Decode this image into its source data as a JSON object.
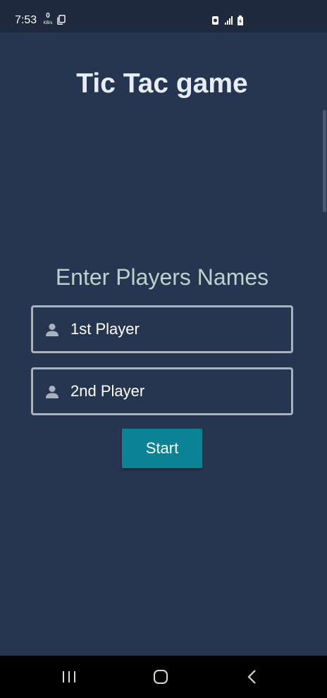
{
  "status_bar": {
    "time": "7:53",
    "network_speed": "0",
    "network_unit": "KB/s"
  },
  "app": {
    "title": "Tic Tac game",
    "players_heading": "Enter Players Names",
    "player1": {
      "placeholder": "1st Player",
      "value": "",
      "icon": "person-icon"
    },
    "player2": {
      "placeholder": "2nd Player",
      "value": "",
      "icon": "person-icon"
    },
    "start_label": "Start"
  },
  "colors": {
    "background": "#273650",
    "status_bar": "#1f2a3e",
    "title": "#e7edf4",
    "heading": "#b9d3cb",
    "input_border": "#a9b1bd",
    "button": "#0b8395",
    "nav_bar": "#000000"
  },
  "nav_bar": {
    "buttons": [
      "recents-icon",
      "home-icon",
      "back-icon"
    ]
  }
}
